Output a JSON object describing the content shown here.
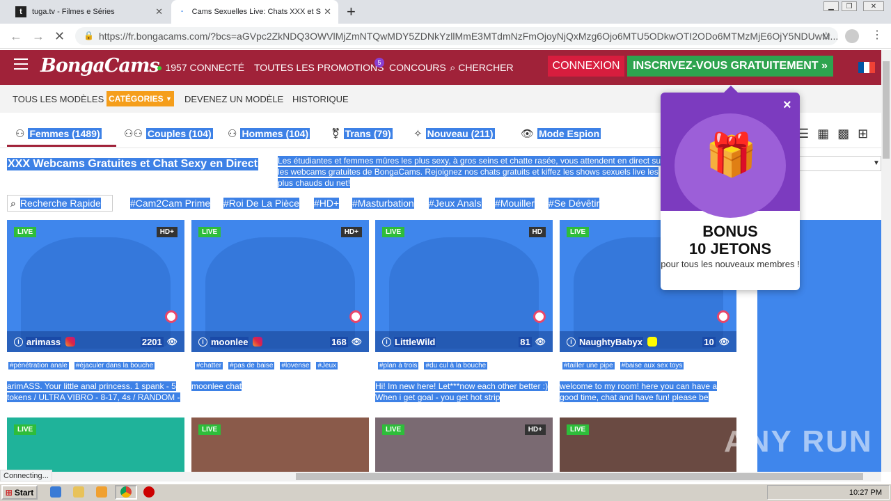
{
  "browser": {
    "tabs": [
      {
        "favicon": "t",
        "title": "tuga.tv - Filmes e Séries"
      },
      {
        "title": "Cams Sexuelles Live: Chats XXX et S"
      }
    ],
    "new_tab": "+",
    "url": "https://fr.bongacams.com/?bcs=aGVpc2ZkNDQ3OWVlMjZmNTQwMDY5ZDNkYzllMmE3MTdmNzFmOjoyNjQxMzg6Ojo6MTU5ODkwOTI2ODo6MTMzMjE6OjY5NDUwM...",
    "status": "Connecting..."
  },
  "site": {
    "logo": "BongaCams",
    "online": "1957 CONNECTÉ",
    "promotions": "TOUTES LES PROMOTIONS",
    "promo_badge": "5",
    "contests": "CONCOURS",
    "search": "CHERCHER",
    "login": "CONNEXION",
    "signup": "INSCRIVEZ-VOUS GRATUITEMENT »",
    "colors": {
      "header": "#a02239",
      "signup": "#2ea44f",
      "login": "#d71d3e",
      "categories": "#f59e1b"
    }
  },
  "subnav": {
    "all_models": "TOUS LES MODÈLES",
    "categories": "CATÉGORIES",
    "become_model": "DEVENEZ UN MODÈLE",
    "history": "HISTORIQUE"
  },
  "cat_tabs": [
    {
      "icon": "user-icon",
      "label": "Femmes (1489)"
    },
    {
      "icon": "couple-icon",
      "label": "Couples (104)"
    },
    {
      "icon": "user-icon",
      "label": "Hommes (104)"
    },
    {
      "icon": "trans-icon",
      "label": "Trans (79)"
    },
    {
      "icon": "sparkle-icon",
      "label": "Nouveau (211)"
    },
    {
      "icon": "eye-icon",
      "label": "Mode Espion"
    }
  ],
  "headline": "XXX Webcams Gratuites et Chat Sexy en Direct",
  "description": "Les étudiantes et femmes mûres les plus sexy, à gros seins et chatte rasée, vous attendent en direct sur les webcams gratuites de BongaCams. Rejoignez nos chats gratuits et kiffez les shows sexuels live les plus chauds du net!",
  "quick_search": "Recherche Rapide",
  "tags": [
    "#Cam2Cam Prime",
    "#Roi De La Pièce",
    "#HD+",
    "#Masturbation",
    "#Jeux Anals",
    "#Mouiller",
    "#Se Dévêtir"
  ],
  "cards": [
    {
      "live": "LIVE",
      "quality": "HD+",
      "name": "arimass",
      "count": "2201",
      "social": "instagram-icon",
      "tags": [
        "#pénétration anale",
        "#éjaculer dans la bouche"
      ],
      "desc": "arimASS. Your little anal princess. 1 spank - 5 tokens / ULTRA VIBRO - 8-17, 4s / RANDOM -"
    },
    {
      "live": "LIVE",
      "quality": "HD+",
      "name": "moonlee",
      "count": "168",
      "social": "instagram-icon",
      "tags": [
        "#chatter",
        "#pas de baise",
        "#lovense",
        "#Jeux"
      ],
      "desc": "moonlee chat"
    },
    {
      "live": "LIVE",
      "quality": "HD",
      "name": "LittleWild",
      "count": "81",
      "social": "",
      "tags": [
        "#plan à trois",
        "#du cul à la bouche"
      ],
      "desc": "Hi! Im new here! Let***now each other better :) When i get goal - you get hot strip"
    },
    {
      "live": "LIVE",
      "quality": "",
      "name": "NaughtyBabyx",
      "count": "10",
      "social": "snapchat-icon",
      "tags": [
        "#tailler une pipe",
        "#baise aux sex toys"
      ],
      "desc": "welcome to my room! here you can have a good time, chat and have fun! please be"
    }
  ],
  "row2": [
    {
      "live": "LIVE",
      "quality": ""
    },
    {
      "live": "LIVE",
      "quality": ""
    },
    {
      "live": "LIVE",
      "quality": "HD+"
    },
    {
      "live": "LIVE",
      "quality": ""
    }
  ],
  "popup": {
    "line1": "BONUS",
    "line2": "10 JETONS",
    "line3": "pour tous les nouveaux membres !",
    "close": "×"
  },
  "watermark": "ANY RUN",
  "taskbar": {
    "start": "Start",
    "clock": "10:27 PM"
  }
}
